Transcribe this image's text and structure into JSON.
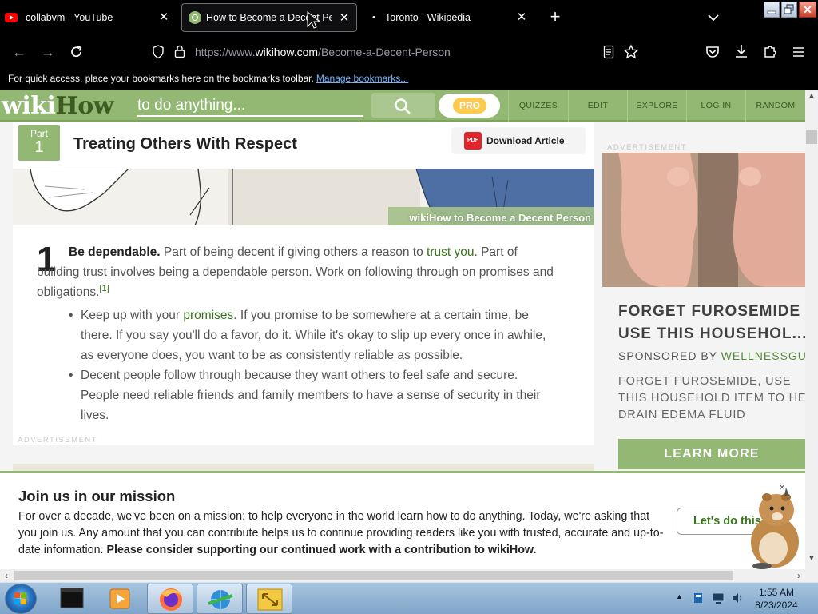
{
  "browser": {
    "tabs": [
      {
        "title": "collabvm - YouTube",
        "favicon": "youtube-icon",
        "active": false
      },
      {
        "title": "How to Become a Decent Person",
        "favicon": "wikihow-icon",
        "active": true
      },
      {
        "title": "Toronto - Wikipedia",
        "favicon": "wikipedia-icon",
        "active": false
      }
    ],
    "url_prefix": "https://www.",
    "url_domain": "wikihow.com",
    "url_path": "/Become-a-Decent-Person",
    "bookmarks_message": "For quick access, place your bookmarks here on the bookmarks toolbar.",
    "bookmarks_link": "Manage bookmarks..."
  },
  "site": {
    "logo_part1": "wiki",
    "logo_part2": "How",
    "search_placeholder": "to do anything...",
    "pro_label": "PRO",
    "nav": [
      "QUIZZES",
      "EDIT",
      "EXPLORE",
      "LOG IN",
      "RANDOM"
    ],
    "brand_color": "#93b874"
  },
  "article": {
    "part_label": "Part",
    "part_number": "1",
    "section_title": "Treating Others With Respect",
    "download_label": "Download Article",
    "image_watermark_a": "wiki",
    "image_watermark_b": "How to Become a Decent Person",
    "step_number": "1",
    "step_bold": "Be dependable.",
    "step_text_1": " Part of being decent if giving others a reason to ",
    "step_link": "trust you",
    "step_text_2": ". Part of building trust involves being a dependable person. Work on following through on promises and obligations.",
    "step_ref": "[1]",
    "bullet1_a": "Keep up with your ",
    "bullet1_link": "promises",
    "bullet1_b": ". If you promise to be somewhere at a certain time, be there. If you say you'll do a favor, do it. While it's okay to slip up every once in awhile, as everyone does, you want to be as consistently reliable as possible.",
    "bullet2": "Decent people follow through because they want others to feel safe and secure. People need reliable friends and family members to have a sense of security in their lives.",
    "ad_label": "ADVERTISEMENT"
  },
  "sidebar_ad": {
    "label": "ADVERTISEMENT",
    "title_line1": "FORGET FUROSEMIDE",
    "title_line2": "USE THIS HOUSEHOL...",
    "sponsor_prefix": "SPONSORED BY ",
    "sponsor_name": "WELLNESSGUID",
    "desc_line1": "FORGET FUROSEMIDE, USE",
    "desc_line2": "THIS HOUSEHOLD ITEM TO HE",
    "desc_line3": "DRAIN EDEMA FLUID",
    "cta": "LEARN MORE"
  },
  "banner": {
    "title": "Join us in our mission",
    "text": "For over a decade, we've been on a mission: to help everyone in the world learn how to do anything. Today, we're asking that you join us. Any amount that you can contribute helps us to continue providing readers like you with trusted, accurate and up-to-date information. ",
    "text_bold": "Please consider supporting our continued work with a contribution to wikiHow.",
    "button": "Let's do this",
    "close": "×"
  },
  "taskbar": {
    "time": "1:55 AM",
    "date": "8/23/2024",
    "apps": [
      "cmd-window-icon",
      "media-player-icon",
      "firefox-icon",
      "network-globe-icon",
      "resize-arrows-icon"
    ]
  }
}
